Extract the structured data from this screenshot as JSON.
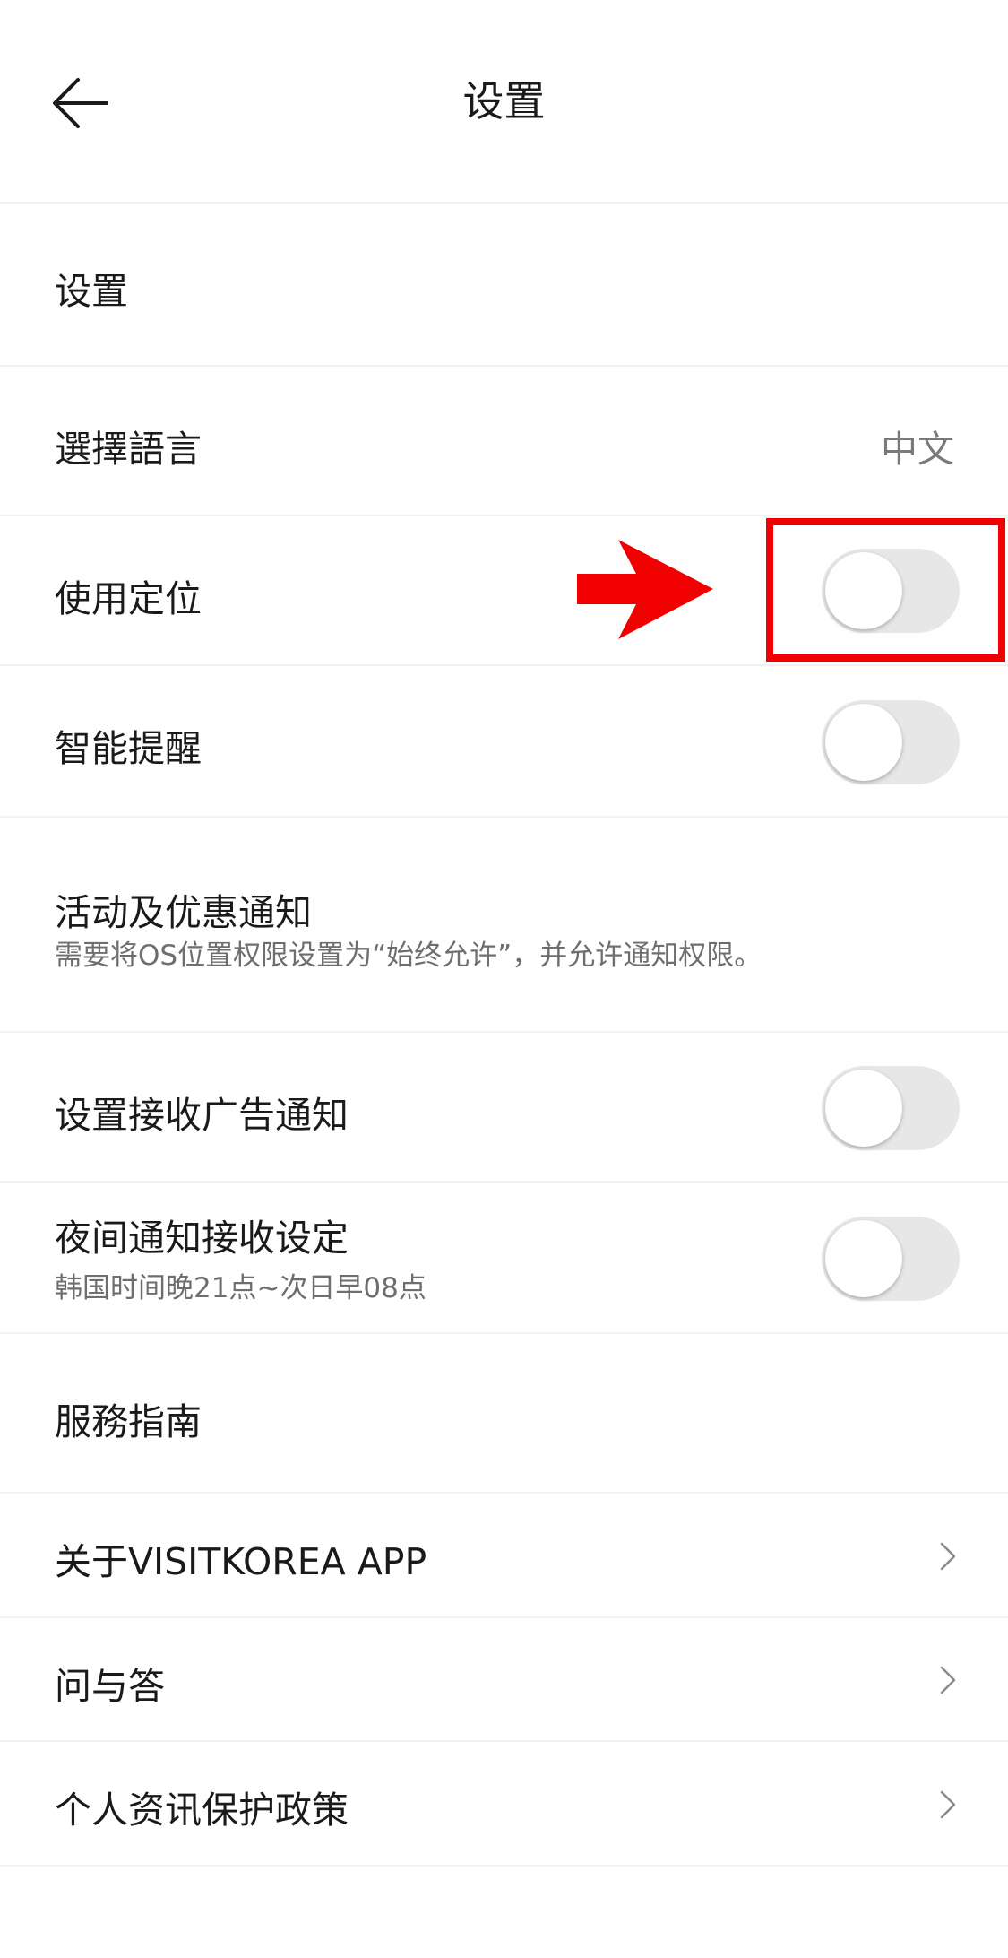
{
  "header": {
    "title": "设置",
    "back_icon": "back-arrow-icon"
  },
  "rows": [
    {
      "label": "设置"
    },
    {
      "label": "選擇語言",
      "value": "中文"
    },
    {
      "label": "使用定位",
      "toggle_on": false
    },
    {
      "label": "智能提醒",
      "toggle_on": false
    },
    {
      "label": "活动及优惠通知",
      "sub": "需要将OS位置权限设置为“始终允许”，并允许通知权限。"
    },
    {
      "label": "设置接收广告通知",
      "toggle_on": false
    },
    {
      "label": "夜间通知接收设定",
      "sub": "韩国时间晚21点~次日早08点",
      "toggle_on": false
    },
    {
      "label": "服務指南"
    },
    {
      "label": "关于VISITKOREA APP",
      "icon": "chevron-right-icon"
    },
    {
      "label": "问与答",
      "icon": "chevron-right-icon"
    },
    {
      "label": "个人资讯保护政策",
      "icon": "chevron-right-icon"
    }
  ],
  "annotation": {
    "color": "#f00000",
    "arrow_icon": "red-arrow-icon"
  },
  "colors": {
    "toggle_off": "#e7e7e7",
    "divider": "#f2f2f2",
    "secondary_text": "#7a7a7a"
  }
}
